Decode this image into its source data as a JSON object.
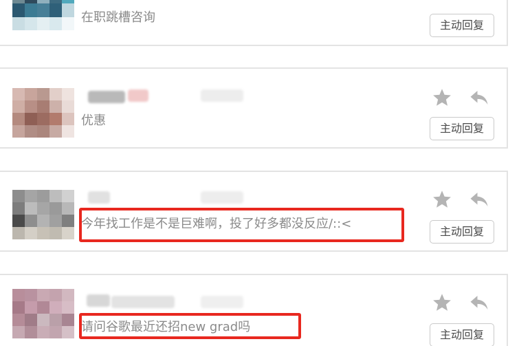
{
  "conversations": [
    {
      "message": "在职跳槽咨询",
      "reply_label": "主动回复"
    },
    {
      "message": "优惠",
      "reply_label": "主动回复"
    },
    {
      "message": "今年找工作是不是巨难啊，投了好多都没反应/::<",
      "reply_label": "主动回复"
    },
    {
      "message": "请问谷歌最近还招new grad吗",
      "reply_label": "主动回复"
    }
  ],
  "icons": {
    "star": "star-icon",
    "reply": "reply-arrow-icon"
  },
  "colors": {
    "highlight": "#e8281f",
    "message_text": "#8a8a8a",
    "icon_gray": "#b4b4b4",
    "card_border": "#e3e3e3"
  }
}
